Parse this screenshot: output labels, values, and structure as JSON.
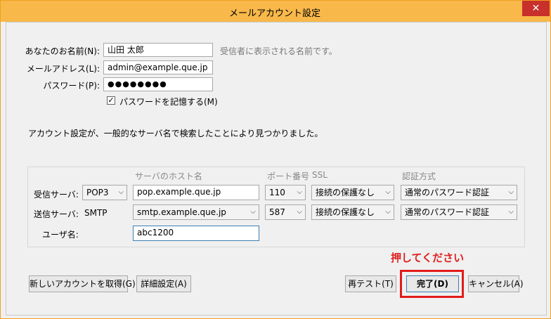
{
  "window": {
    "title": "メールアカウント設定",
    "close_glyph": "✕"
  },
  "form": {
    "name_label": "あなたのお名前(N):",
    "name_value": "山田 太郎",
    "name_hint": "受信者に表示される名前です。",
    "email_label": "メールアドレス(L):",
    "email_value": "admin@example.que.jp",
    "password_label": "パスワード(P):",
    "password_value": "●●●●●●●●",
    "remember_label": "パスワードを記憶する(M)",
    "remember_checked": "✓"
  },
  "status_message": "アカウント設定が、一般的なサーバ名で検索したことにより見つかりました。",
  "server_table": {
    "headers": {
      "host": "サーバのホスト名",
      "port": "ポート番号",
      "ssl": "SSL",
      "auth": "認証方式"
    },
    "incoming": {
      "label": "受信サーバ:",
      "protocol": "POP3",
      "host": "pop.example.que.jp",
      "port": "110",
      "ssl": "接続の保護なし",
      "auth": "通常のパスワード認証"
    },
    "outgoing": {
      "label": "送信サーバ:",
      "protocol": "SMTP",
      "host": "smtp.example.que.jp",
      "port": "587",
      "ssl": "接続の保護なし",
      "auth": "通常のパスワード認証"
    },
    "username_label": "ユーザ名:",
    "username_value": "abc1200"
  },
  "buttons": {
    "new_account": "新しいアカウントを取得(G)",
    "advanced": "詳細設定(A)",
    "retest": "再テスト(T)",
    "done": "完了(D)",
    "cancel": "キャンセル(A)"
  },
  "callout": "押してください",
  "colors": {
    "highlight": "#e21b1b",
    "titlebar": "#f8b84a",
    "close": "#c7302b"
  }
}
